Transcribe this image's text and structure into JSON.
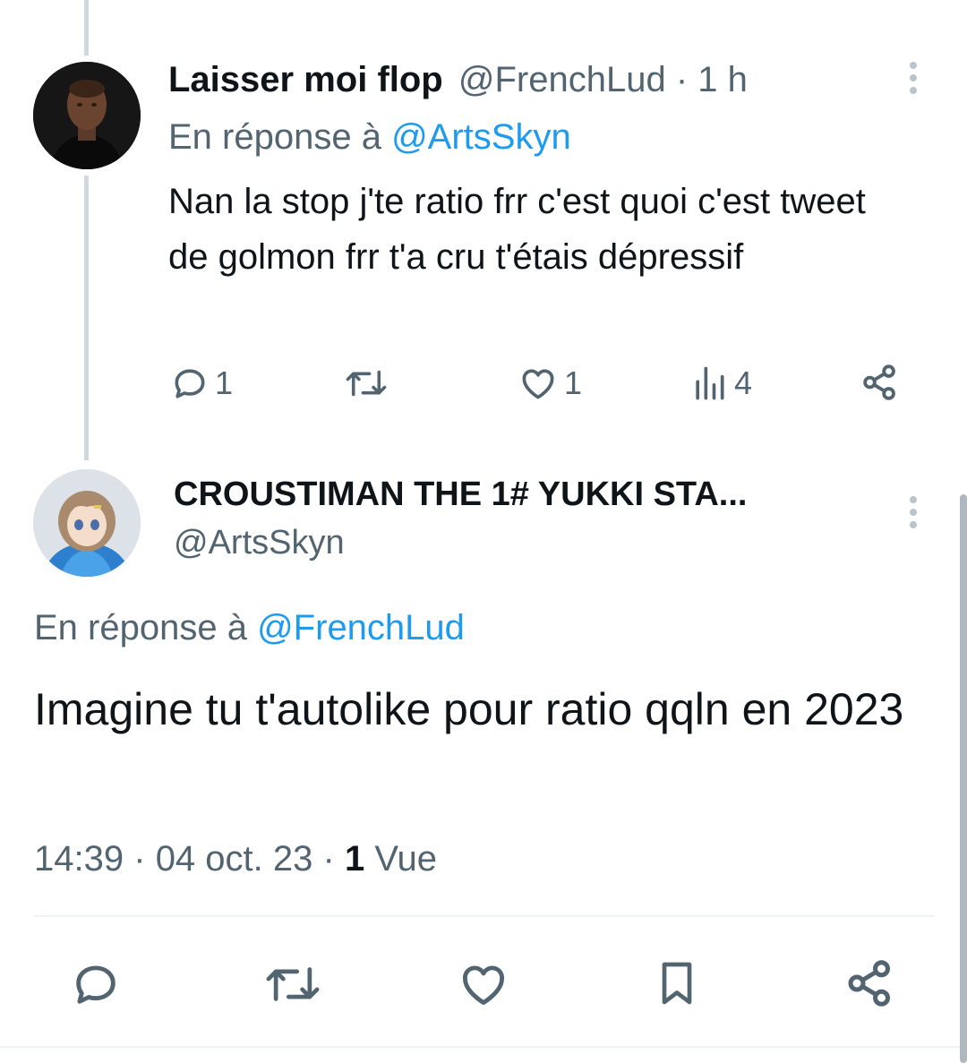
{
  "reply_tweet": {
    "display_name": "Laisser moi flop",
    "handle": "@FrenchLud",
    "sep": "·",
    "time_ago": "1 h",
    "reply_prefix": "En réponse à",
    "reply_to": "@ArtsSkyn",
    "text": "Nan la stop j'te ratio frr c'est quoi c'est tweet de golmon frr t'a cru t'étais dépressif",
    "replies": "1",
    "likes": "1",
    "views": "4",
    "avatar_icon": "profile-photo-man"
  },
  "main_tweet": {
    "display_name": "CROUSTIMAN THE 1# YUKKI STA...",
    "handle": "@ArtsSkyn",
    "reply_prefix": "En réponse à",
    "reply_to": "@FrenchLud",
    "text": "Imagine tu t'autolike pour ratio qqln en 2023",
    "time": "14:39",
    "sep1": "·",
    "date": "04 oct. 23",
    "sep2": "·",
    "views_count": "1",
    "views_label": "Vue",
    "avatar_icon": "anime-girl-avatar"
  },
  "colors": {
    "link": "#1d9bf0",
    "muted": "#536471",
    "text": "#0f1419",
    "thread_line": "#cfd9de"
  },
  "icons": [
    "reply-icon",
    "retweet-icon",
    "like-icon",
    "views-icon",
    "share-icon",
    "bookmark-icon",
    "more-icon"
  ]
}
